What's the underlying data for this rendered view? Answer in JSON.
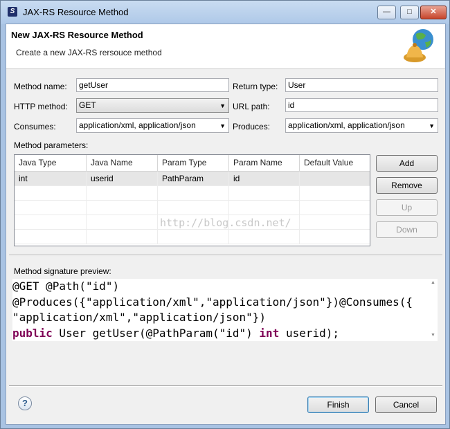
{
  "window": {
    "title": "JAX-RS Resource Method",
    "minimize": "—",
    "maximize": "□",
    "close": "✕"
  },
  "banner": {
    "title": "New JAX-RS Resource Method",
    "description": "Create a new JAX-RS rersouce method"
  },
  "form": {
    "method_name_label": "Method name:",
    "method_name_value": "getUser",
    "return_type_label": "Return type:",
    "return_type_value": "User",
    "http_method_label": "HTTP method:",
    "http_method_value": "GET",
    "url_path_label": "URL path:",
    "url_path_value": "id",
    "consumes_label": "Consumes:",
    "consumes_value": "application/xml, application/json",
    "produces_label": "Produces:",
    "produces_value": "application/xml, application/json",
    "params_label": "Method parameters:"
  },
  "params_table": {
    "columns": [
      "Java Type",
      "Java Name",
      "Param Type",
      "Param Name",
      "Default Value"
    ],
    "rows": [
      [
        "int",
        "userid",
        "PathParam",
        "id",
        ""
      ]
    ]
  },
  "param_buttons": {
    "add": "Add",
    "remove": "Remove",
    "up": "Up",
    "down": "Down"
  },
  "preview": {
    "label": "Method signature preview:",
    "line1": "@GET @Path(\"id\")",
    "line2": "@Produces({\"application/xml\",\"application/json\"})@Consumes({",
    "line3": "\"application/xml\",\"application/json\"})",
    "line4_kw1": "public",
    "line4_mid": " User getUser(@PathParam(\"id\") ",
    "line4_kw2": "int",
    "line4_end": " userid);"
  },
  "watermark": "http://blog.csdn.net/",
  "footer": {
    "help": "?",
    "finish": "Finish",
    "cancel": "Cancel"
  }
}
